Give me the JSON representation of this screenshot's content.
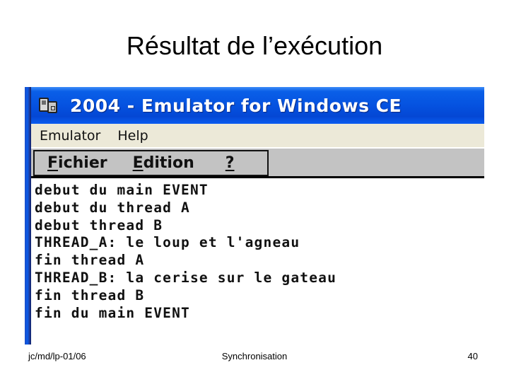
{
  "slide": {
    "title": "Résultat de l’exécution"
  },
  "window": {
    "title": "2004 - Emulator for Windows CE",
    "icon": "device-emulator-icon",
    "accent_color": "#0552e0",
    "menu": [
      "Emulator",
      "Help"
    ]
  },
  "ce_app": {
    "menu": [
      {
        "accesskey": "F",
        "rest": "ichier",
        "label": "Fichier"
      },
      {
        "accesskey": "E",
        "rest": "dition",
        "label": "Edition"
      },
      {
        "accesskey": "?",
        "rest": "",
        "label": "?"
      }
    ],
    "output_lines": [
      "debut du main EVENT",
      "debut du thread A",
      "debut thread B",
      "THREAD_A: le loup et l'agneau",
      "fin thread A",
      "THREAD_B: la cerise sur le gateau",
      "fin thread B",
      "fin du main EVENT"
    ]
  },
  "footer": {
    "left": "jc/md/lp-01/06",
    "center": "Synchronisation",
    "right": "40"
  }
}
